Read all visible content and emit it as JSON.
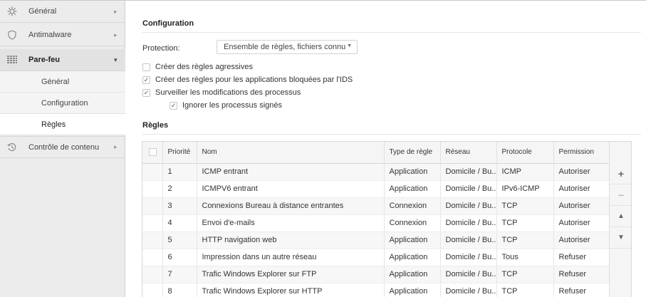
{
  "sidebar": {
    "items": [
      {
        "label": "Général",
        "icon": "gear-icon"
      },
      {
        "label": "Antimalware",
        "icon": "shield-icon"
      },
      {
        "label": "Pare-feu",
        "icon": "firewall-icon"
      },
      {
        "label": "Contrôle de contenu",
        "icon": "history-icon"
      }
    ],
    "subitems": [
      {
        "label": "Général"
      },
      {
        "label": "Configuration"
      },
      {
        "label": "Règles"
      }
    ]
  },
  "main": {
    "config_title": "Configuration",
    "protection_label": "Protection:",
    "protection_value": "Ensemble de règles, fichiers connu",
    "options": [
      {
        "label": "Créer des règles agressives",
        "checked": false
      },
      {
        "label": "Créer des règles pour les applications bloquées par l'IDS",
        "checked": true
      },
      {
        "label": "Surveiller les modifications des processus",
        "checked": true
      },
      {
        "label": "Ignorer les processus signés",
        "checked": true
      }
    ],
    "rules_title": "Règles"
  },
  "table": {
    "headers": [
      "Priorité",
      "Nom",
      "Type de règle",
      "Réseau",
      "Protocole",
      "Permission"
    ],
    "rows": [
      [
        "1",
        "ICMP entrant",
        "Application",
        "Domicile / Bu...",
        "ICMP",
        "Autoriser"
      ],
      [
        "2",
        "ICMPV6 entrant",
        "Application",
        "Domicile / Bu...",
        "IPv6-ICMP",
        "Autoriser"
      ],
      [
        "3",
        "Connexions Bureau à distance entrantes",
        "Connexion",
        "Domicile / Bu...",
        "TCP",
        "Autoriser"
      ],
      [
        "4",
        "Envoi d'e-mails",
        "Connexion",
        "Domicile / Bu...",
        "TCP",
        "Autoriser"
      ],
      [
        "5",
        "HTTP navigation web",
        "Application",
        "Domicile / Bu...",
        "TCP",
        "Autoriser"
      ],
      [
        "6",
        "Impression dans un autre réseau",
        "Application",
        "Domicile / Bu...",
        "Tous",
        "Refuser"
      ],
      [
        "7",
        "Trafic Windows Explorer sur FTP",
        "Application",
        "Domicile / Bu...",
        "TCP",
        "Refuser"
      ],
      [
        "8",
        "Trafic Windows Explorer sur HTTP",
        "Application",
        "Domicile / Bu...",
        "TCP",
        "Refuser"
      ]
    ],
    "buttons": {
      "add": "+",
      "remove": "−",
      "up": "▲",
      "down": "▼"
    }
  }
}
